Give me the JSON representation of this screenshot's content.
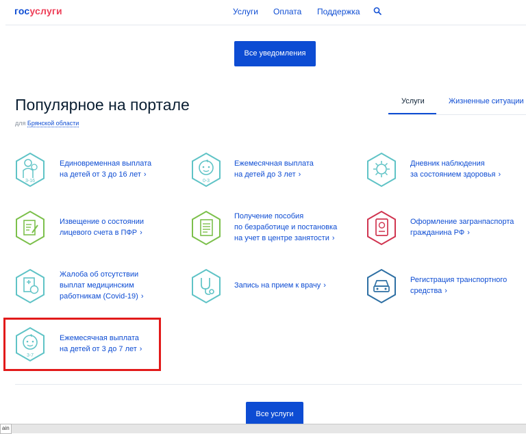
{
  "header": {
    "logo_part1": "гос",
    "logo_part2": "услуги",
    "nav": [
      "Услуги",
      "Оплата",
      "Поддержка"
    ],
    "search_icon": "search-icon"
  },
  "notifications_button": "Все уведомления",
  "popular": {
    "title": "Популярное на портале",
    "region_prefix": "для",
    "region_link": "Брянской области"
  },
  "tabs": [
    {
      "label": "Услуги",
      "active": true
    },
    {
      "label": "Жизненные ситуации",
      "active": false
    }
  ],
  "services": [
    {
      "lines": [
        "Единовременная выплата",
        "на детей от 3 до 16 лет"
      ],
      "icon": "child-3-16-icon",
      "icon_text": "3-16",
      "color": "#5fc3c6"
    },
    {
      "lines": [
        "Ежемесячная выплата",
        "на детей до 3 лет"
      ],
      "icon": "baby-0-3-icon",
      "icon_text": "0-3",
      "color": "#5fc3c6"
    },
    {
      "lines": [
        "Дневник наблюдения",
        "за состоянием здоровья"
      ],
      "icon": "virus-icon",
      "icon_text": "",
      "color": "#5fc3c6"
    },
    {
      "lines": [
        "Извещение о состоянии",
        "лицевого счета в ПФР"
      ],
      "icon": "document-edit-icon",
      "icon_text": "",
      "color": "#7cc04b"
    },
    {
      "lines": [
        "Получение пособия",
        "по безработице и постановка",
        "на учет в центре занятости"
      ],
      "icon": "document-list-icon",
      "icon_text": "",
      "color": "#7cc04b"
    },
    {
      "lines": [
        "Оформление загранпаспорта",
        "гражданина РФ"
      ],
      "icon": "passport-icon",
      "icon_text": "",
      "color": "#d0344f"
    },
    {
      "lines": [
        "Жалоба об отсутствии",
        "выплат медицинским",
        "работникам (Covid-19)"
      ],
      "icon": "medical-payment-icon",
      "icon_text": "",
      "color": "#5fc3c6"
    },
    {
      "lines": [
        "Запись на прием к врачу"
      ],
      "icon": "stethoscope-icon",
      "icon_text": "",
      "color": "#5fc3c6"
    },
    {
      "lines": [
        "Регистрация транспортного",
        "средства"
      ],
      "icon": "car-icon",
      "icon_text": "",
      "color": "#2d6fa3"
    },
    {
      "lines": [
        "Ежемесячная выплата",
        "на детей от 3 до 7 лет"
      ],
      "icon": "child-3-7-icon",
      "icon_text": "3-7",
      "color": "#5fc3c6"
    }
  ],
  "chevron": "›",
  "all_services_button": "Все услуги",
  "status_fragment": "ain"
}
